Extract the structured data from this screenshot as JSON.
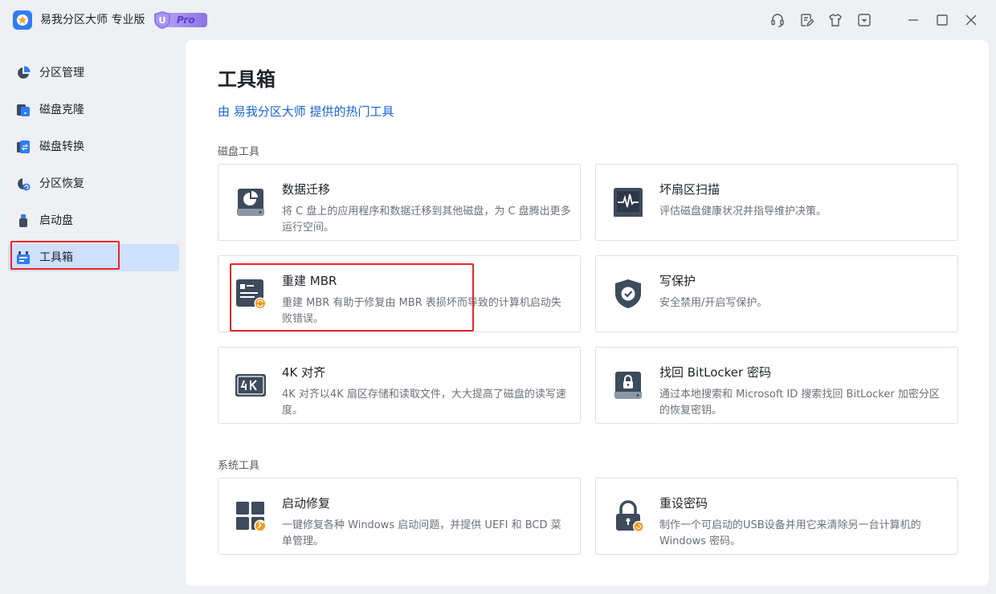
{
  "app": {
    "title": "易我分区大师 专业版",
    "badge_letter": "U",
    "badge_text": "Pro"
  },
  "titlebar_icons": [
    "headset-icon",
    "edit-note-icon",
    "tshirt-icon",
    "dropdown-box-icon",
    "minimize-icon",
    "maximize-icon",
    "close-icon"
  ],
  "sidebar": {
    "items": [
      {
        "label": "分区管理",
        "icon": "pie-chart-icon",
        "active": false
      },
      {
        "label": "磁盘克隆",
        "icon": "disk-clone-icon",
        "active": false
      },
      {
        "label": "磁盘转换",
        "icon": "disk-convert-icon",
        "active": false
      },
      {
        "label": "分区恢复",
        "icon": "partition-recovery-icon",
        "active": false
      },
      {
        "label": "启动盘",
        "icon": "usb-drive-icon",
        "active": false
      },
      {
        "label": "工具箱",
        "icon": "toolbox-icon",
        "active": true
      }
    ]
  },
  "main": {
    "title": "工具箱",
    "subtitle": "由 易我分区大师 提供的热门工具",
    "sections": [
      {
        "label": "磁盘工具",
        "cards": [
          {
            "title": "数据迁移",
            "desc": "将 C 盘上的应用程序和数据迁移到其他磁盘，为 C 盘腾出更多运行空间。",
            "icon": "data-migration-icon"
          },
          {
            "title": "坏扇区扫描",
            "desc": "评估磁盘健康状况并指导维护决策。",
            "icon": "bad-sector-scan-icon"
          },
          {
            "title": "重建 MBR",
            "desc": "重建 MBR 有助于修复由 MBR 表损坏而导致的计算机启动失败错误。",
            "icon": "rebuild-mbr-icon"
          },
          {
            "title": "写保护",
            "desc": "安全禁用/开启写保护。",
            "icon": "shield-check-icon"
          },
          {
            "title": "4K 对齐",
            "desc": "4K 对齐以4K 扇区存储和读取文件，大大提高了磁盘的读写速度。",
            "icon": "4k-align-icon"
          },
          {
            "title": "找回 BitLocker 密码",
            "desc": "通过本地搜索和 Microsoft ID 搜索找回 BitLocker 加密分区的恢复密钥。",
            "icon": "bitlocker-lock-icon"
          }
        ]
      },
      {
        "label": "系统工具",
        "cards": [
          {
            "title": "启动修复",
            "desc": "一键修复各种 Windows 启动问题，并提供 UEFI 和 BCD 菜单管理。",
            "icon": "boot-repair-icon"
          },
          {
            "title": "重设密码",
            "desc": "制作一个可启动的USB设备并用它来清除另一台计算机的 Windows 密码。",
            "icon": "reset-password-icon"
          }
        ]
      }
    ]
  },
  "colors": {
    "accent": "#1a63d6",
    "active_nav": "#cfe0fd",
    "highlight_box": "#e8262a",
    "icon_dark": "#3d4b5c",
    "icon_orange": "#f39a1e"
  }
}
